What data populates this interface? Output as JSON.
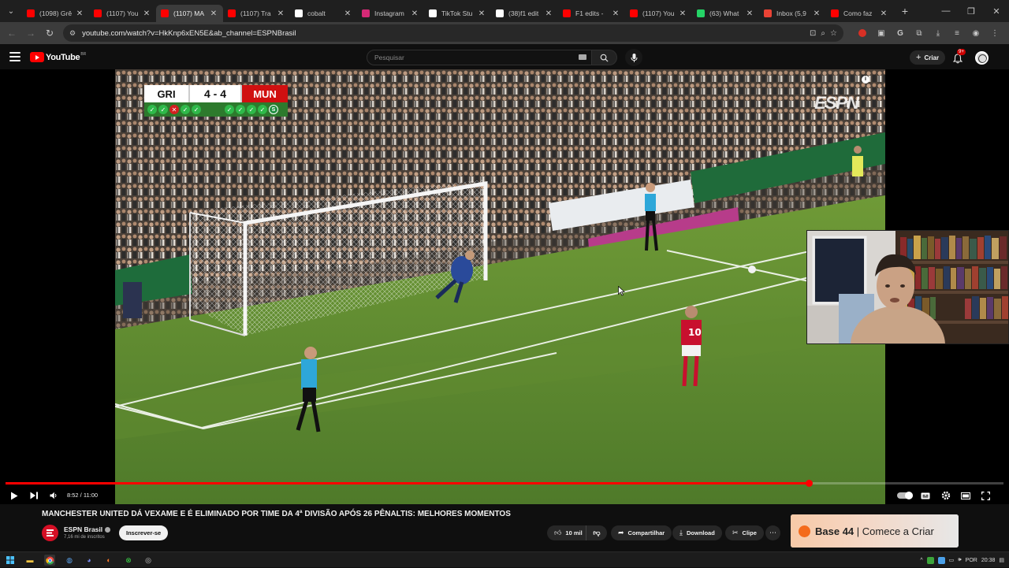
{
  "browser": {
    "tabs": [
      {
        "label": "(1098) Grê",
        "icon": "youtube-icon",
        "color": "#ff0000"
      },
      {
        "label": "(1107) You",
        "icon": "youtube-icon",
        "color": "#ff0000"
      },
      {
        "label": "(1107) MA",
        "icon": "youtube-icon",
        "color": "#ff0000",
        "active": true
      },
      {
        "label": "(1107) Tra",
        "icon": "youtube-icon",
        "color": "#ff0000"
      },
      {
        "label": "cobalt",
        "icon": "cobalt-icon",
        "color": "#ffffff"
      },
      {
        "label": "Instagram",
        "icon": "instagram-icon",
        "color": "#d62976"
      },
      {
        "label": "TikTok Stu",
        "icon": "tiktok-icon",
        "color": "#ffffff"
      },
      {
        "label": "(38)f1 edit",
        "icon": "tiktok-icon",
        "color": "#ffffff"
      },
      {
        "label": "F1 edits - ",
        "icon": "youtube-icon",
        "color": "#ff0000"
      },
      {
        "label": "(1107) You",
        "icon": "youtube-icon",
        "color": "#ff0000"
      },
      {
        "label": "(63) What",
        "icon": "whatsapp-icon",
        "color": "#25d366"
      },
      {
        "label": "Inbox (5,9",
        "icon": "gmail-icon",
        "color": "#ea4335"
      },
      {
        "label": "Como faz",
        "icon": "youtube-icon",
        "color": "#ff0000"
      }
    ],
    "url": "youtube.com/watch?v=HkKnp6xEN5E&ab_channel=ESPNBrasil"
  },
  "youtube": {
    "logo_text": "YouTube",
    "region": "BR",
    "search_placeholder": "Pesquisar",
    "create_label": "Criar",
    "notification_count": "9+"
  },
  "player": {
    "scoreboard": {
      "home": "GRI",
      "score": "4 - 4",
      "away": "MUN",
      "home_pens": [
        "ok",
        "ok",
        "miss",
        "ok",
        "ok"
      ],
      "away_pens": [
        "ok",
        "ok",
        "ok",
        "ok",
        "pending"
      ],
      "pending_label": "S"
    },
    "broadcaster": "ESPN",
    "time_current": "8:52",
    "time_total": "11:00",
    "time_display": "8:52 / 11:00",
    "progress": 0.805
  },
  "video": {
    "title": "MANCHESTER UNITED DÁ VEXAME E É ELIMINADO POR TIME DA 4ª DIVISÃO APÓS 26 PÊNALTIS: MELHORES MOMENTOS",
    "channel": "ESPN Brasil",
    "subscribers": "7,16 mi de inscritos",
    "subscribe_label": "Inscrever-se",
    "likes": "10 mil",
    "share_label": "Compartilhar",
    "download_label": "Download",
    "clip_label": "Clipe"
  },
  "ad": {
    "brand": "Base 44",
    "separator": " | ",
    "cta": "Comece a Criar"
  },
  "taskbar": {
    "language": "POR",
    "clock": "20:38"
  }
}
